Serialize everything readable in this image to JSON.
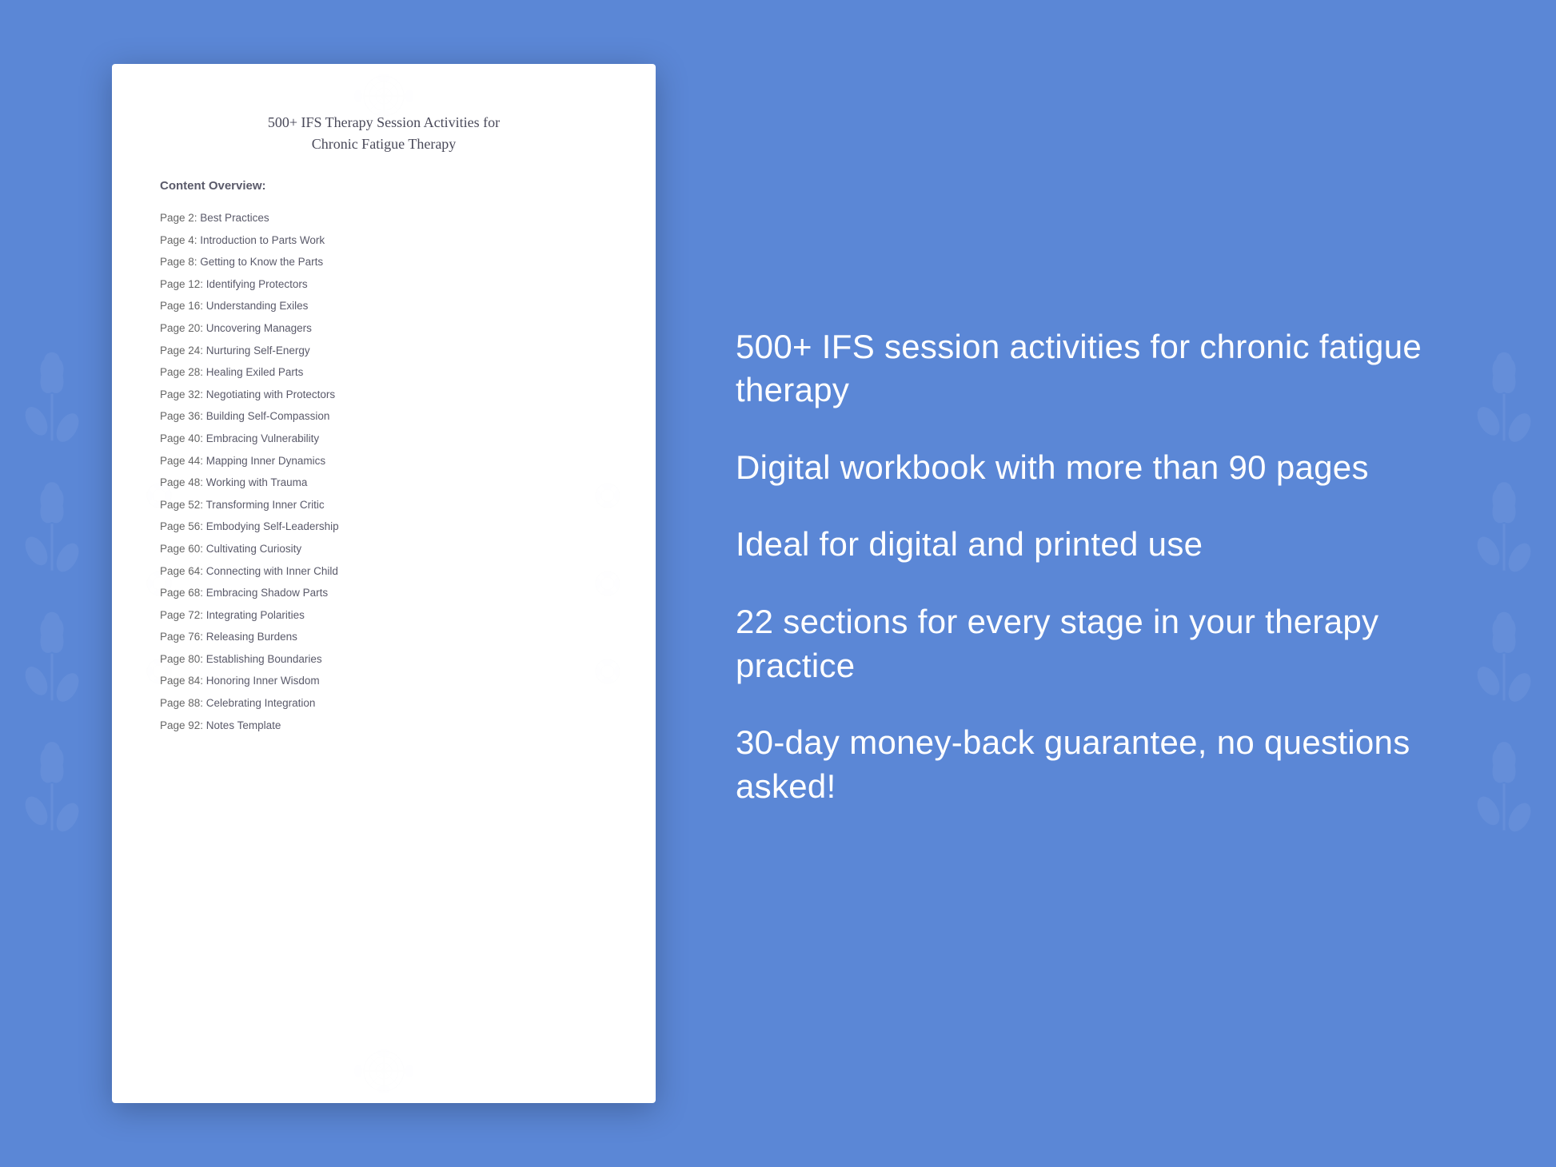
{
  "background_color": "#5b87d6",
  "document": {
    "title_line1": "500+ IFS Therapy Session Activities for",
    "title_line2": "Chronic Fatigue Therapy",
    "section_header": "Content Overview:",
    "toc_entries": [
      {
        "page": "Page  2:",
        "title": "Best Practices"
      },
      {
        "page": "Page  4:",
        "title": "Introduction to Parts Work"
      },
      {
        "page": "Page  8:",
        "title": "Getting to Know the Parts"
      },
      {
        "page": "Page 12:",
        "title": "Identifying Protectors"
      },
      {
        "page": "Page 16:",
        "title": "Understanding Exiles"
      },
      {
        "page": "Page 20:",
        "title": "Uncovering Managers"
      },
      {
        "page": "Page 24:",
        "title": "Nurturing Self-Energy"
      },
      {
        "page": "Page 28:",
        "title": "Healing Exiled Parts"
      },
      {
        "page": "Page 32:",
        "title": "Negotiating with Protectors"
      },
      {
        "page": "Page 36:",
        "title": "Building Self-Compassion"
      },
      {
        "page": "Page 40:",
        "title": "Embracing Vulnerability"
      },
      {
        "page": "Page 44:",
        "title": "Mapping Inner Dynamics"
      },
      {
        "page": "Page 48:",
        "title": "Working with Trauma"
      },
      {
        "page": "Page 52:",
        "title": "Transforming Inner Critic"
      },
      {
        "page": "Page 56:",
        "title": "Embodying Self-Leadership"
      },
      {
        "page": "Page 60:",
        "title": "Cultivating Curiosity"
      },
      {
        "page": "Page 64:",
        "title": "Connecting with Inner Child"
      },
      {
        "page": "Page 68:",
        "title": "Embracing Shadow Parts"
      },
      {
        "page": "Page 72:",
        "title": "Integrating Polarities"
      },
      {
        "page": "Page 76:",
        "title": "Releasing Burdens"
      },
      {
        "page": "Page 80:",
        "title": "Establishing Boundaries"
      },
      {
        "page": "Page 84:",
        "title": "Honoring Inner Wisdom"
      },
      {
        "page": "Page 88:",
        "title": "Celebrating Integration"
      },
      {
        "page": "Page 92:",
        "title": "Notes Template"
      }
    ]
  },
  "features": [
    "500+ IFS session activities for chronic fatigue therapy",
    "Digital workbook with more than 90 pages",
    "Ideal for digital and printed use",
    "22 sections for every stage in your therapy practice",
    "30-day money-back guarantee, no questions asked!"
  ]
}
